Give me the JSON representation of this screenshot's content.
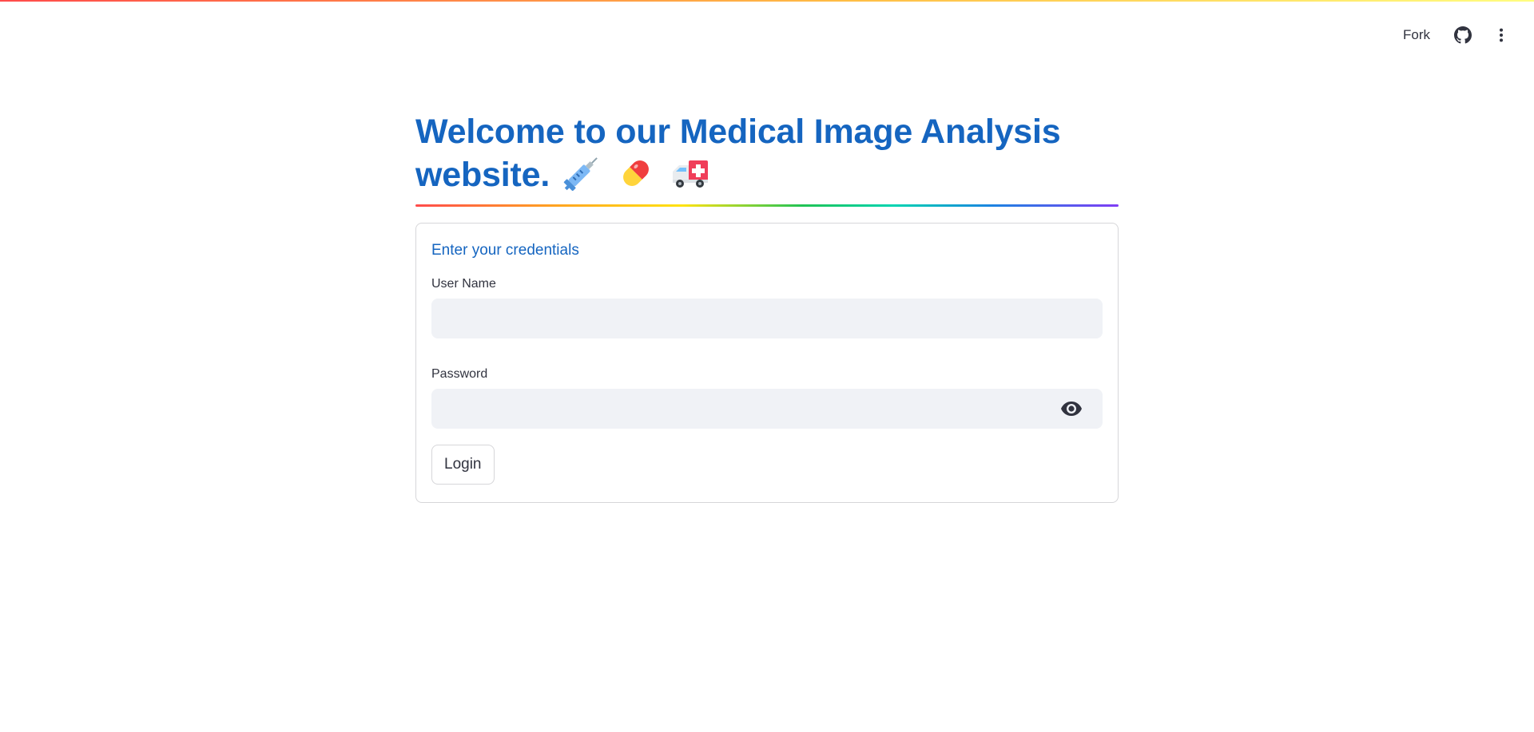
{
  "toolbar": {
    "fork_label": "Fork",
    "github_icon": "github-icon",
    "menu_icon": "more-vert-icon"
  },
  "header": {
    "title": "Welcome to our Medical Image Analysis website.",
    "emojis": [
      "syringe-icon",
      "pill-icon",
      "ambulance-icon"
    ]
  },
  "form": {
    "heading": "Enter your credentials",
    "username": {
      "label": "User Name",
      "value": "",
      "placeholder": ""
    },
    "password": {
      "label": "Password",
      "value": "",
      "placeholder": "",
      "toggle_icon": "eye-icon"
    },
    "submit_label": "Login"
  },
  "colors": {
    "title": "#1565c0",
    "input_bg": "#f0f2f6",
    "border": "#d6d6d9",
    "text": "#31333f"
  }
}
